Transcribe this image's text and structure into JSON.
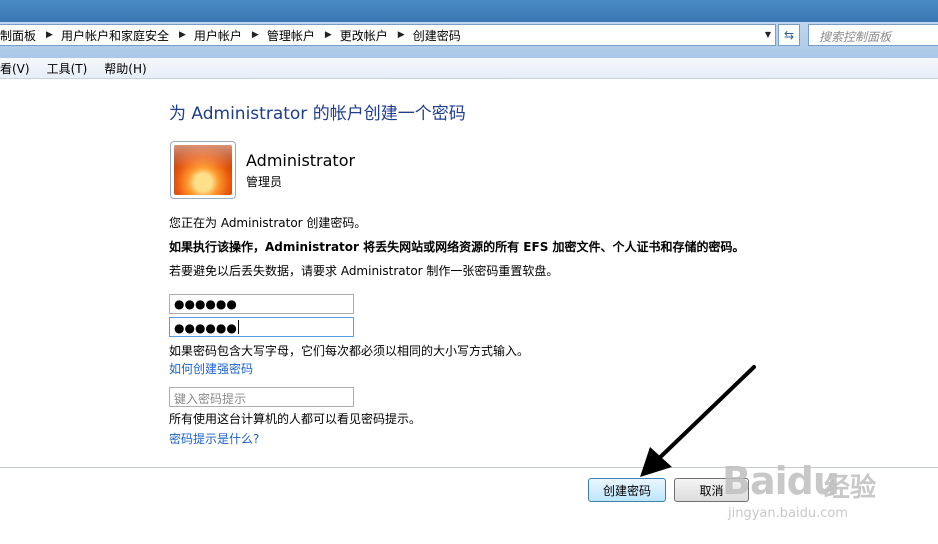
{
  "address_bar": {
    "breadcrumbs": [
      "制面板",
      "用户帐户和家庭安全",
      "用户帐户",
      "管理帐户",
      "更改帐户",
      "创建密码"
    ]
  },
  "search": {
    "placeholder": "搜索控制面板"
  },
  "menu": {
    "items": [
      "看(V)",
      "工具(T)",
      "帮助(H)"
    ]
  },
  "page": {
    "title": "为 Administrator 的帐户创建一个密码",
    "account_name": "Administrator",
    "account_type": "管理员",
    "info_line": "您正在为 Administrator 创建密码。",
    "warning_line": "如果执行该操作，Administrator 将丢失网站或网络资源的所有 EFS 加密文件、个人证书和存储的密码。",
    "advice_line": "若要避免以后丢失数据，请要求 Administrator 制作一张密码重置软盘。"
  },
  "form": {
    "password_value": "●●●●●●",
    "confirm_value": "●●●●●●",
    "case_note": "如果密码包含大写字母，它们每次都必须以相同的大小写方式输入。",
    "strong_password_link": "如何创建强密码",
    "hint_placeholder": "键入密码提示",
    "hint_note": "所有使用这台计算机的人都可以看见密码提示。",
    "hint_link": "密码提示是什么?"
  },
  "buttons": {
    "create": "创建密码",
    "cancel": "取消"
  },
  "watermark": {
    "logo": "Baidu",
    "text": "经验",
    "url": "jingyan.baidu.com"
  }
}
